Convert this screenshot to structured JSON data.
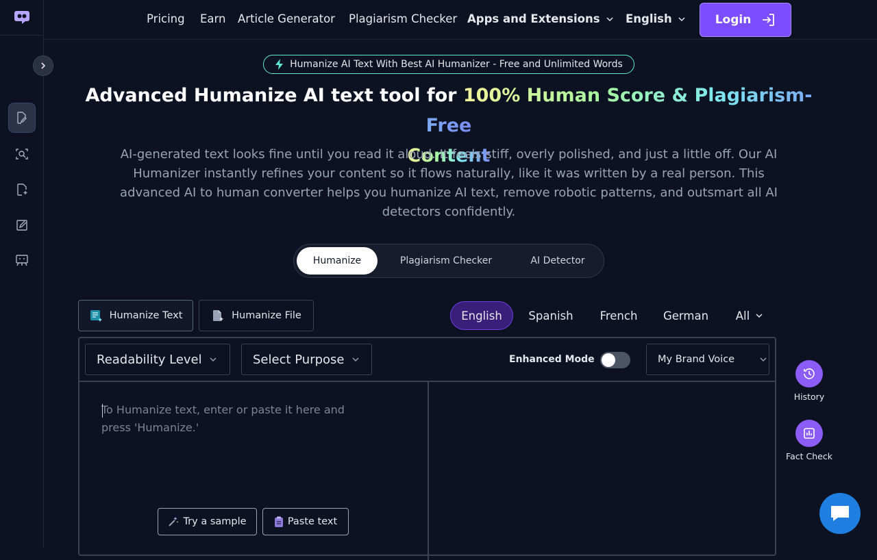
{
  "nav": {
    "links": [
      "Pricing",
      "Earn",
      "Article Generator",
      "Plagiarism Checker"
    ],
    "apps": "Apps and Extensions",
    "language": "English",
    "login": "Login"
  },
  "hero": {
    "badge": "Humanize AI Text With Best AI Humanizer - Free and Unlimited Words",
    "headline_plain": "Advanced Humanize AI text tool for ",
    "headline_gradient_line1": "100% Human Score & Plagiarism-Free",
    "headline_gradient_line2": "Content",
    "description": "AI-generated text looks fine until you read it aloud. It feels stiff, overly polished, and just a little off. Our AI Humanizer instantly refines your content so it flows naturally, like it was written by a real person. This advanced AI to human converter helps you humanize AI text, remove robotic patterns, and outsmart all AI detectors confidently."
  },
  "mode_tabs": [
    "Humanize",
    "Plagiarism Checker",
    "AI Detector"
  ],
  "input_types": [
    "Humanize Text",
    "Humanize File"
  ],
  "languages": [
    "English",
    "Spanish",
    "French",
    "German",
    "All"
  ],
  "toolbar": {
    "readability": "Readability Level",
    "purpose": "Select Purpose",
    "enhanced_mode": "Enhanced Mode",
    "brand_voice": "My Brand Voice"
  },
  "editor": {
    "placeholder": "To Humanize text, enter or paste it here and press 'Humanize.'",
    "try_sample": "Try a sample",
    "paste_text": "Paste text"
  },
  "floating": {
    "history": "History",
    "fact_check": "Fact Check"
  },
  "colors": {
    "accent": "#7c4dff",
    "float_purple": "#8b5cf6",
    "chat_blue": "#1e7fe0",
    "badge_border": "#5eead4"
  }
}
